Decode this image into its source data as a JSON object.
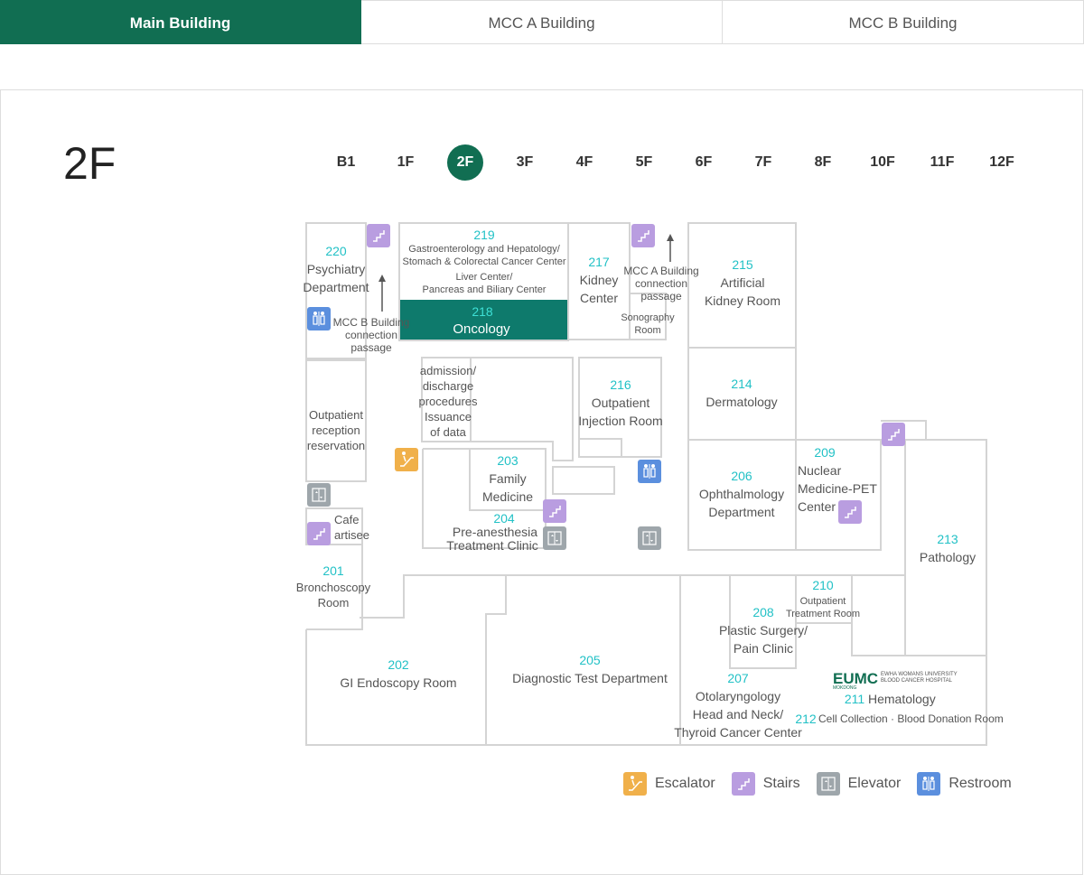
{
  "tabs": [
    {
      "label": "Main Building",
      "active": true
    },
    {
      "label": "MCC A Building",
      "active": false
    },
    {
      "label": "MCC B Building",
      "active": false
    }
  ],
  "floor_title": "2F",
  "floors": [
    "B1",
    "1F",
    "2F",
    "3F",
    "4F",
    "5F",
    "6F",
    "7F",
    "8F",
    "10F",
    "11F",
    "12F"
  ],
  "current_floor": "2F",
  "rooms": {
    "r220": {
      "num": "220",
      "l1": "Psychiatry",
      "l2": "Department"
    },
    "r219": {
      "num": "219",
      "l1": "Gastroenterology and Hepatology/",
      "l2": "Stomach & Colorectal Cancer Center",
      "l3": "Liver Center/",
      "l4": "Pancreas and Biliary Center"
    },
    "r218": {
      "num": "218",
      "l1": "Oncology"
    },
    "r217": {
      "num": "217",
      "l1": "Kidney",
      "l2": "Center"
    },
    "r215": {
      "num": "215",
      "l1": "Artificial",
      "l2": "Kidney Room"
    },
    "r214": {
      "num": "214",
      "l1": "Dermatology"
    },
    "r216": {
      "num": "216",
      "l1": "Outpatient",
      "l2": "Injection Room"
    },
    "admission": {
      "l1": "admission/",
      "l2": "discharge",
      "l3": "procedures",
      "l4": "Issuance",
      "l5": "of data"
    },
    "outpatient_reception": {
      "l1": "Outpatient",
      "l2": "reception",
      "l3": "reservation"
    },
    "r203": {
      "num": "203",
      "l1": "Family",
      "l2": "Medicine"
    },
    "r204": {
      "num": "204",
      "l1": "Pre-anesthesia",
      "l2": "Treatment Clinic"
    },
    "r206": {
      "num": "206",
      "l1": "Ophthalmology",
      "l2": "Department"
    },
    "r209": {
      "num": "209",
      "l1": "Nuclear",
      "l2": "Medicine-PET",
      "l3": "Center"
    },
    "r213": {
      "num": "213",
      "l1": "Pathology"
    },
    "cafe": {
      "l1": "Cafe",
      "l2": "artisee"
    },
    "r201": {
      "num": "201",
      "l1": "Bronchoscopy",
      "l2": "Room"
    },
    "r202": {
      "num": "202",
      "l1": "GI Endoscopy Room"
    },
    "r205": {
      "num": "205",
      "l1": "Diagnostic Test Department"
    },
    "r210": {
      "num": "210",
      "l1": "Outpatient",
      "l2": "Treatment Room"
    },
    "r208": {
      "num": "208",
      "l1": "Plastic Surgery/",
      "l2": "Pain Clinic"
    },
    "r207": {
      "num": "207",
      "l1": "Otolaryngology",
      "l2": "Head and Neck/",
      "l3": "Thyroid Cancer Center"
    },
    "r211": {
      "num": "211",
      "l1": "Hematology"
    },
    "r212": {
      "num": "212",
      "l1": "Cell Collection · Blood Donation Room"
    },
    "sonography": {
      "l1": "Sonography",
      "l2": "Room"
    },
    "mcc_a_passage": {
      "l1": "MCC A Building",
      "l2": "connection",
      "l3": "passage"
    },
    "mcc_b_passage": {
      "l1": "MCC B Building",
      "l2": "connection",
      "l3": "passage"
    }
  },
  "logo": {
    "mark": "EUMC",
    "line1": "EWHA WOMANS UNIVERSITY",
    "line2": "BLOOD CANCER HOSPITAL",
    "sub": "MOKDONG"
  },
  "legend": [
    {
      "label": "Escalator",
      "icon": "escalator-icon",
      "color": "#f0b04a"
    },
    {
      "label": "Stairs",
      "icon": "stairs-icon",
      "color": "#b99de0"
    },
    {
      "label": "Elevator",
      "icon": "elevator-icon",
      "color": "#9ea6ab"
    },
    {
      "label": "Restroom",
      "icon": "restroom-icon",
      "color": "#5b8fde"
    }
  ],
  "colors": {
    "accent": "#116e52",
    "room_number": "#22c1c6",
    "oncology_fill": "#0e7a6c"
  }
}
